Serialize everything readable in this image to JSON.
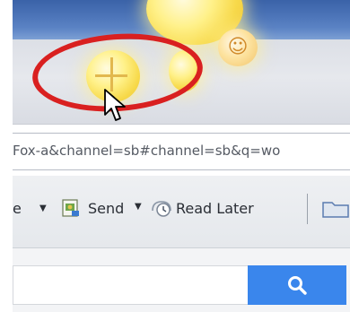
{
  "window": {
    "title_bar_color": "#3a62a8"
  },
  "address_bar": {
    "url_fragment": "Fox-a&channel=sb#channel=sb&q=wo"
  },
  "toolbar": {
    "partial_label": "e",
    "send_label": "Send",
    "read_later_label": "Read Later",
    "icons": [
      "send-page-icon",
      "read-later-clock-icon",
      "folder-icon"
    ]
  },
  "search": {
    "button_icon": "search-icon",
    "button_color": "#3a86ec"
  },
  "annotation": {
    "circle_color": "#d92020"
  }
}
